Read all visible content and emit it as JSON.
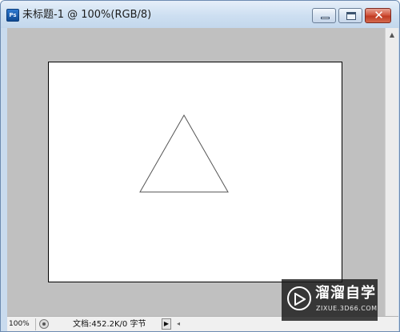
{
  "window": {
    "app_icon_text": "Ps",
    "title": "未标题-1 @ 100%(RGB/8)",
    "close_glyph": "✕"
  },
  "document": {
    "background": "#ffffff",
    "shape": "triangle",
    "stroke": "#555555"
  },
  "status_bar": {
    "zoom": "100%",
    "doc_info": "文档:452.2K/0 字节",
    "menu_arrow": "▶",
    "scroll_left_arrow": "◂"
  },
  "scrollbar": {
    "up_arrow": "▲"
  },
  "watermark": {
    "brand": "溜溜自学",
    "url": "ZIXUE.3D66.COM"
  }
}
